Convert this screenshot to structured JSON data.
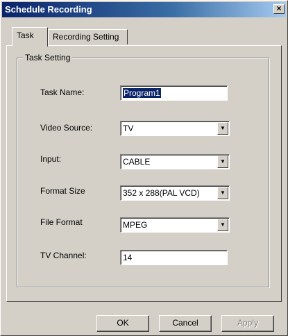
{
  "window": {
    "title": "Schedule Recording",
    "close_symbol": "×"
  },
  "tabs": [
    {
      "label": "Task",
      "active": true
    },
    {
      "label": "Recording Setting",
      "active": false
    }
  ],
  "group": {
    "title": "Task Setting"
  },
  "fields": {
    "task_name": {
      "label": "Task Name:",
      "value": "Program1"
    },
    "video_source": {
      "label": "Video Source:",
      "value": "TV"
    },
    "input": {
      "label": "Input:",
      "value": "CABLE"
    },
    "format_size": {
      "label": "Format Size",
      "value": "352 x 288(PAL VCD)"
    },
    "file_format": {
      "label": "File Format",
      "value": "MPEG"
    },
    "tv_channel": {
      "label": "TV Channel:",
      "value": "14"
    }
  },
  "buttons": {
    "ok": "OK",
    "cancel": "Cancel",
    "apply": "Apply"
  },
  "icons": {
    "dropdown": "▼"
  }
}
